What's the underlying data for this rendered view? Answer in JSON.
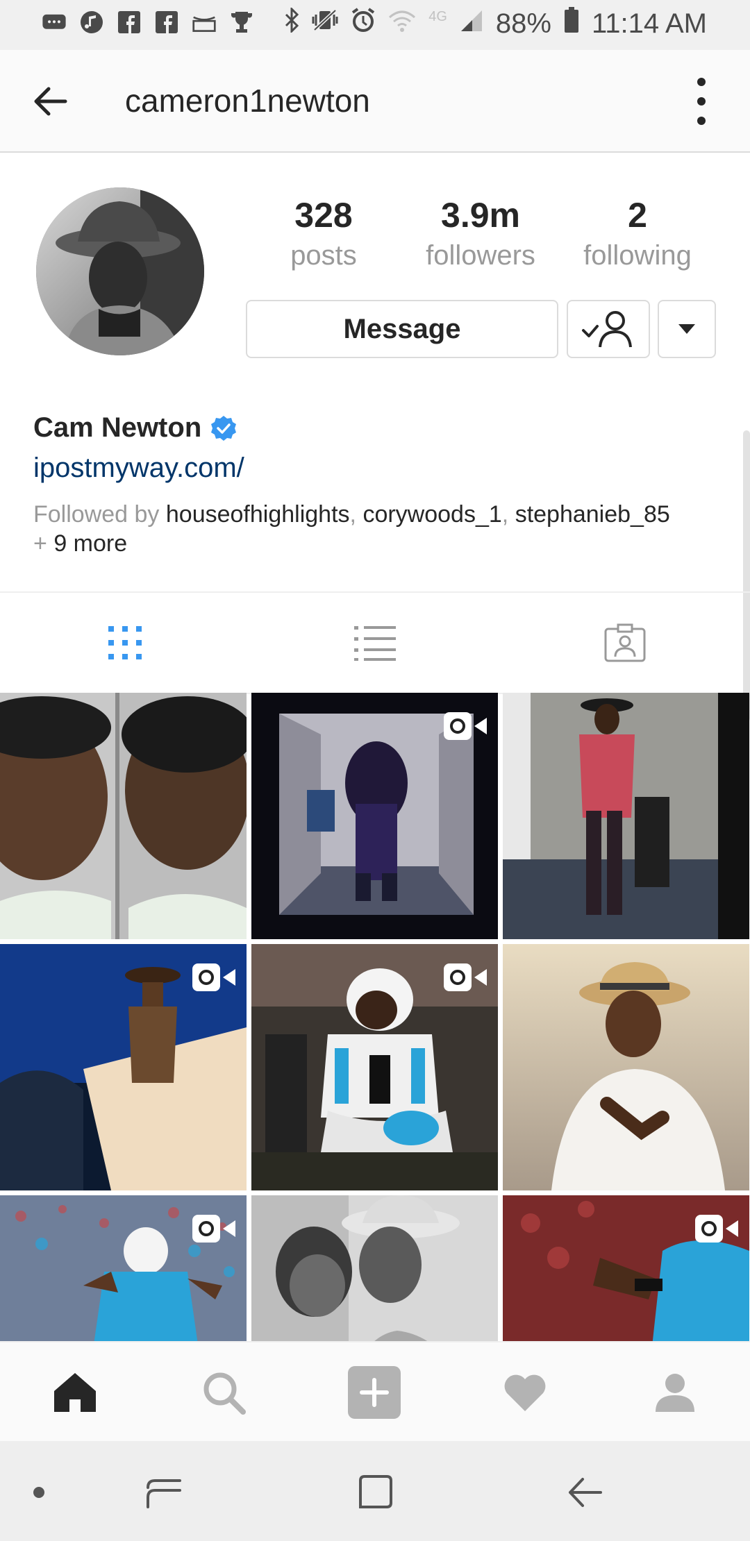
{
  "status_bar": {
    "battery": "88%",
    "time": "11:14 AM",
    "network": "4G",
    "icons_left": [
      "message-icon",
      "music-icon",
      "facebook-icon",
      "facebook-icon",
      "amazon-icon",
      "trophy-icon"
    ],
    "icons_right": [
      "bluetooth-icon",
      "vibrate-icon",
      "alarm-icon",
      "wifi-icon",
      "signal-icon",
      "battery-icon"
    ]
  },
  "header": {
    "username": "cameron1newton"
  },
  "profile": {
    "stats": [
      {
        "value": "328",
        "label": "posts"
      },
      {
        "value": "3.9m",
        "label": "followers"
      },
      {
        "value": "2",
        "label": "following"
      }
    ],
    "message_label": "Message",
    "name": "Cam Newton",
    "link": "ipostmyway.com/",
    "followed_by_prefix": "Followed by ",
    "followed_by": [
      "houseofhighlights",
      "corywoods_1",
      "stephanieb_85"
    ],
    "separator": ", ",
    "more_prefix": "+ ",
    "more_count": "9 more"
  },
  "tabs": [
    "grid-view",
    "list-view",
    "tagged-view"
  ],
  "colors": {
    "accent": "#3897f0",
    "link": "#003569",
    "border": "#dbdbdb",
    "muted": "#999999"
  }
}
